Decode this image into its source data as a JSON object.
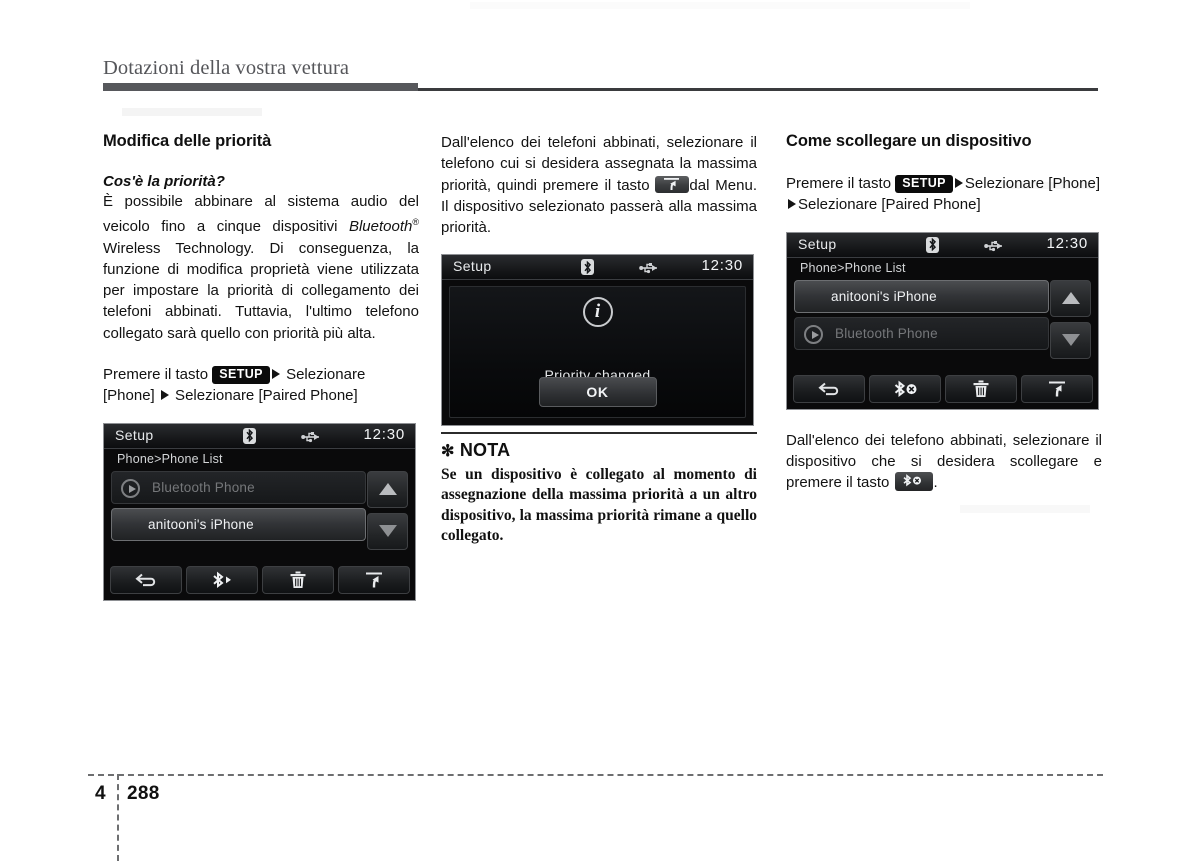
{
  "header": {
    "running_title": "Dotazioni della vostra vettura"
  },
  "footer": {
    "chapter": "4",
    "page": "288"
  },
  "columns": {
    "col1": {
      "section_title": "Modifica delle priorità",
      "sub_title": "Cos'è la priorità?",
      "body_part1": "È possibile abbinare al sistema audio del veicolo fino a cinque dispositivi ",
      "bluetooth_word": "Bluetooth",
      "registered_mark": "®",
      "body_part2": " Wireless Technology. Di conseguenza, la funzione di modifica proprietà viene utilizzata per impostare la priorità di collegamento dei telefoni abbinati. Tuttavia, l'ultimo telefono collegato sarà quello con priorità più alta.",
      "instruction_prefix": "Premere il tasto ",
      "setup_badge": "SETUP",
      "instruction_mid": " Selezionare [Phone] ",
      "instruction_suffix": " Selezionare [Paired Phone]"
    },
    "col2": {
      "body_part1": "Dall'elenco dei telefoni abbinati, selezionare il telefono cui si desidera assegnata la massima priorità, quindi premere il tasto ",
      "body_part2": "dal Menu. Il dispositivo selezionato passerà alla massima priorità.",
      "nota_star": "✻",
      "nota_title": "NOTA",
      "nota_body": "Se un dispositivo è collegato al momento di assegnazione della massima priorità a un altro dispositivo, la massima priorità rimane a quello collegato."
    },
    "col3": {
      "section_title": "Come scollegare un dispositivo",
      "instruction_prefix": "Premere il tasto ",
      "setup_badge": "SETUP",
      "instruction_mid": "Selezionare [Phone]",
      "instruction_suffix": "Selezionare [Paired Phone]",
      "body_part1": "Dall'elenco dei telefono abbinati, selezionare il dispositivo che si desidera scollegare e premere il tasto ",
      "body_part2": "."
    }
  },
  "screenshots": {
    "phone_list_before": {
      "status_title": "Setup",
      "clock": "12:30",
      "bt_icon": "bluetooth-icon",
      "usb_icon": "usb-icon",
      "breadcrumb": "Phone>Phone List",
      "rows": [
        {
          "label": "Bluetooth Phone",
          "state": "dim",
          "has_play_badge": true
        },
        {
          "label": "anitooni's iPhone",
          "state": "selected",
          "has_play_badge": false
        }
      ],
      "buttons": [
        {
          "icon": "back-arrow-icon"
        },
        {
          "icon": "bluetooth-connect-icon"
        },
        {
          "icon": "trash-icon"
        },
        {
          "icon": "priority-up-icon"
        }
      ]
    },
    "priority_dialog": {
      "status_title": "Setup",
      "clock": "12:30",
      "bt_icon": "bluetooth-icon",
      "usb_icon": "usb-icon",
      "info_glyph": "i",
      "message": "Priority changed",
      "ok_label": "OK"
    },
    "phone_list_after": {
      "status_title": "Setup",
      "clock": "12:30",
      "bt_icon": "bluetooth-icon",
      "usb_icon": "usb-icon",
      "breadcrumb": "Phone>Phone List",
      "rows": [
        {
          "label": "anitooni's iPhone",
          "state": "selected",
          "has_play_badge": false
        },
        {
          "label": "Bluetooth Phone",
          "state": "dim",
          "has_play_badge": true
        }
      ],
      "buttons": [
        {
          "icon": "back-arrow-icon"
        },
        {
          "icon": "bluetooth-disconnect-icon"
        },
        {
          "icon": "trash-icon"
        },
        {
          "icon": "priority-up-icon"
        }
      ]
    }
  },
  "colors": {
    "rule_dark": "#57585c",
    "text": "#121212",
    "header_text": "#55565a",
    "badge_bg": "#0b0b0b"
  }
}
